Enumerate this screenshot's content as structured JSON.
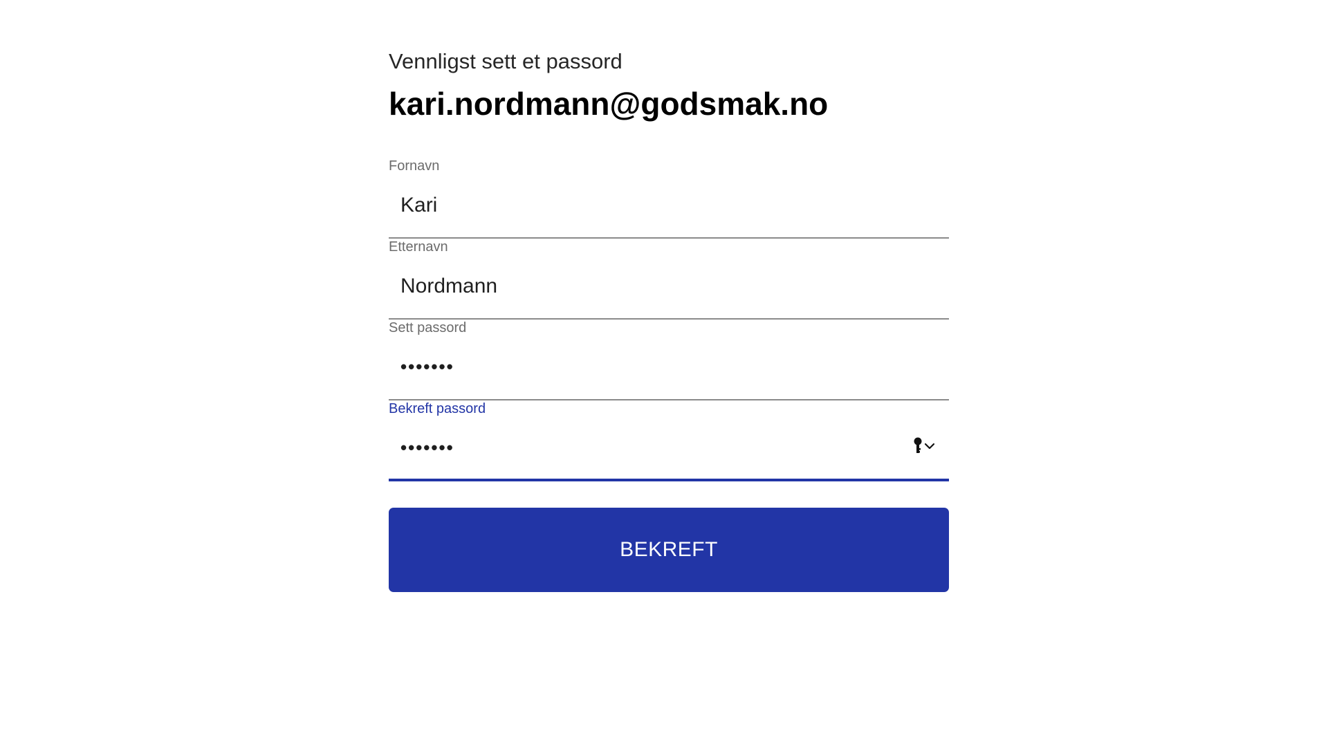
{
  "header": {
    "subtitle": "Vennligst sett et passord",
    "email": "kari.nordmann@godsmak.no"
  },
  "fields": {
    "first_name": {
      "label": "Fornavn",
      "value": "Kari"
    },
    "last_name": {
      "label": "Etternavn",
      "value": "Nordmann"
    },
    "password": {
      "label": "Sett passord",
      "value": "•••••••"
    },
    "confirm_password": {
      "label": "Bekreft passord",
      "value": "•••••••"
    }
  },
  "icons": {
    "password_manager": "key-icon",
    "dropdown": "chevron-down-icon"
  },
  "submit": {
    "label": "BEKREFT"
  },
  "colors": {
    "accent": "#2235a6",
    "label": "#6b6b6b",
    "underline": "#8a8a8a"
  }
}
